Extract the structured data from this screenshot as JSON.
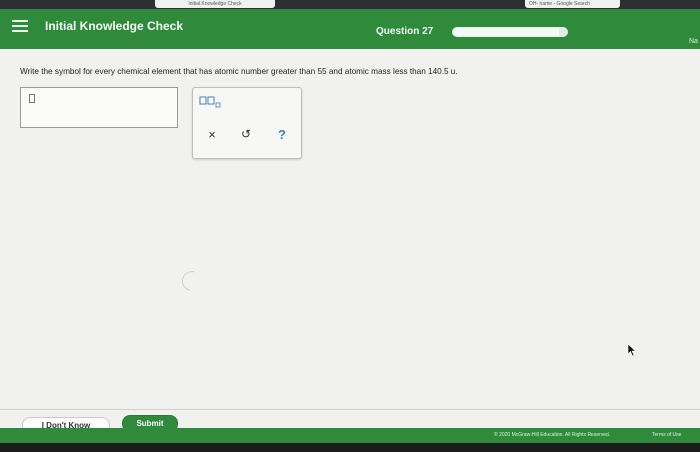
{
  "browser": {
    "tabs": [
      {
        "label": "Initial Knowledge Check"
      },
      {
        "label": "OH- name - Google Search"
      }
    ]
  },
  "header": {
    "title": "Initial Knowledge Check",
    "question_label": "Question 27",
    "progress_fraction": 0.93,
    "next_label": "Na"
  },
  "question": {
    "text": "Write the symbol for every chemical element that has atomic number greater than 55 and atomic mass less than 140.5 u."
  },
  "answer": {
    "value": ""
  },
  "palette": {
    "tools": [
      {
        "icon": "subscript-template-icon"
      },
      {
        "icon": "clear-icon",
        "glyph": "×"
      },
      {
        "icon": "undo-icon",
        "glyph": "↺"
      },
      {
        "icon": "help-icon",
        "glyph": "?"
      }
    ]
  },
  "footer": {
    "dont_know_label": "I Don't Know",
    "submit_label": "Submit",
    "copyright": "© 2020 McGraw-Hill Education. All Rights Reserved.",
    "terms": "Terms of Use"
  },
  "colors": {
    "brand_green": "#2f8a3c",
    "help_blue": "#3f7ec2"
  }
}
